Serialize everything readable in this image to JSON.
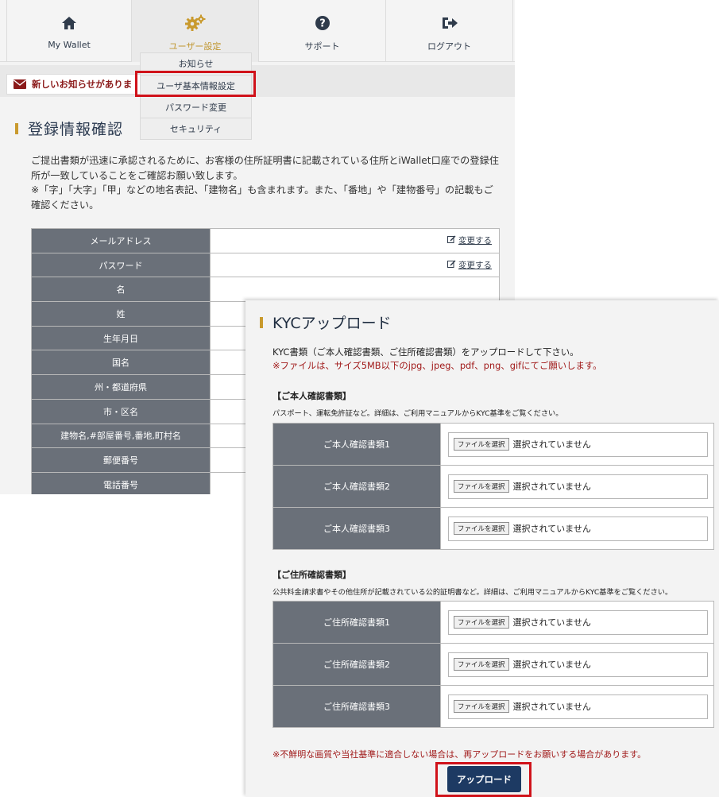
{
  "nav": {
    "items": [
      {
        "label": "My Wallet",
        "icon": "home-icon"
      },
      {
        "label": "ユーザー設定",
        "icon": "gears-icon"
      },
      {
        "label": "サポート",
        "icon": "question-circle-icon"
      },
      {
        "label": "ログアウト",
        "icon": "sign-out-icon"
      }
    ],
    "dropdown": [
      "お知らせ",
      "ユーザ基本情報設定",
      "パスワード変更",
      "セキュリティ"
    ]
  },
  "notice": {
    "text": "新しいお知らせがありま",
    "icon": "envelope-icon"
  },
  "register": {
    "title": "登録情報確認",
    "intro_line1": "ご提出書類が迅速に承認されるために、お客様の住所証明書に記載されている住所とiWallet口座での登録住所が一致していることをご確認お願い致します。",
    "intro_line2": "※「字」「大字」「甲」などの地名表記、「建物名」も含まれます。また、「番地」や「建物番号」の記載もご確認ください。",
    "change_label": "変更する",
    "rows": [
      "メールアドレス",
      "パスワード",
      "名",
      "姓",
      "生年月日",
      "国名",
      "州・都道府県",
      "市・区名",
      "建物名,#部屋番号,番地,町村名",
      "郵便番号",
      "電話番号"
    ]
  },
  "kyc": {
    "title": "KYCアップロード",
    "intro": "KYC書類（ご本人確認書類、ご住所確認書類）をアップロードして下さい。",
    "note": "※ファイルは、サイズ5MB以下のjpg、jpeg、pdf、png、gifにてご願いします。",
    "identity": {
      "heading": "【ご本人確認書類】",
      "desc": "パスポート、運転免許証など。詳細は、ご利用マニュアルからKYC基準をご覧ください。",
      "rows": [
        "ご本人確認書類1",
        "ご本人確認書類2",
        "ご本人確認書類3"
      ]
    },
    "address": {
      "heading": "【ご住所確認書類】",
      "desc": "公共料金請求書やその他住所が記載されている公的証明書など。詳細は、ご利用マニュアルからKYC基準をご覧ください。",
      "rows": [
        "ご住所確認書類1",
        "ご住所確認書類2",
        "ご住所確認書類3"
      ]
    },
    "file_button": "ファイルを選択",
    "file_status": "選択されていません",
    "warning": "※不鮮明な画質や当社基準に適合しない場合は、再アップロードをお願いする場合があります。",
    "upload_button": "アップロード"
  },
  "colors": {
    "accent": "#c99a2e",
    "highlight": "#d0121a",
    "label_bg": "#6a7079",
    "button_bg": "#1d3a63",
    "alert_text": "#a11b1b"
  }
}
